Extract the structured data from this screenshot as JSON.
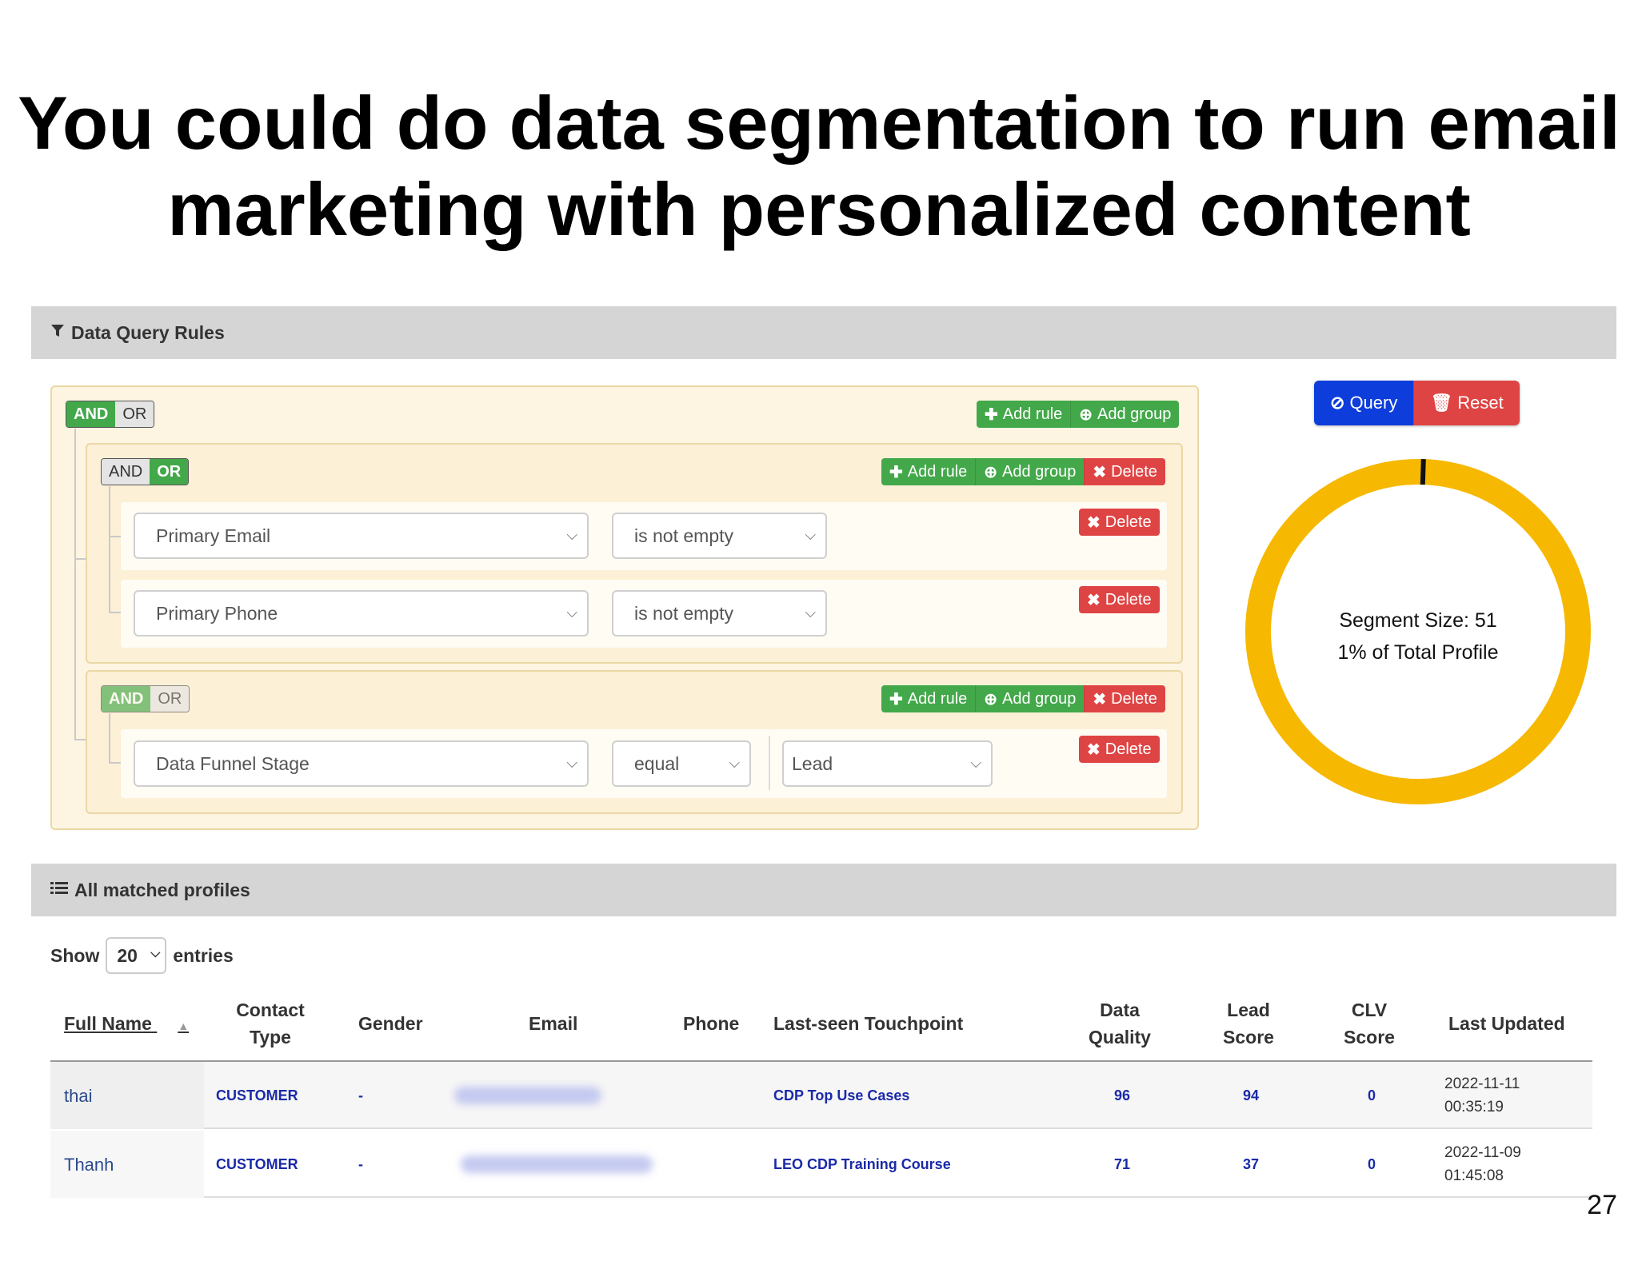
{
  "slide": {
    "title_line1": "You could do data segmentation to run email",
    "title_line2": "marketing with personalized content",
    "page_number": "27"
  },
  "query_section": {
    "title": "Data Query Rules",
    "icon": "filter-icon"
  },
  "root_group": {
    "and_label": "AND",
    "or_label": "OR",
    "active": "AND",
    "add_rule": "Add rule",
    "add_group": "Add group"
  },
  "group1": {
    "and_label": "AND",
    "or_label": "OR",
    "active": "OR",
    "add_rule": "Add rule",
    "add_group": "Add group",
    "delete": "Delete",
    "rules": [
      {
        "field": "Primary Email",
        "operator": "is not empty",
        "delete": "Delete"
      },
      {
        "field": "Primary Phone",
        "operator": "is not empty",
        "delete": "Delete"
      }
    ]
  },
  "group2": {
    "and_label": "AND",
    "or_label": "OR",
    "active": "AND",
    "add_rule": "Add rule",
    "add_group": "Add group",
    "delete": "Delete",
    "rules": [
      {
        "field": "Data Funnel Stage",
        "operator": "equal",
        "value": "Lead",
        "delete": "Delete"
      }
    ]
  },
  "actions": {
    "query": "Query",
    "reset": "Reset",
    "query_color": "#0d3ddb",
    "reset_color": "#df4444"
  },
  "segment": {
    "size_text": "Segment Size: 51",
    "percent_text": "1% of Total Profile",
    "fraction": 0.01,
    "ring_color": "#f6b800"
  },
  "profiles_section": {
    "title": "All matched profiles",
    "icon": "list-icon"
  },
  "table": {
    "show_label": "Show",
    "entries_value": "20",
    "entries_label": "entries",
    "headers": {
      "full_name": "Full Name",
      "contact_type_1": "Contact",
      "contact_type_2": "Type",
      "gender": "Gender",
      "email": "Email",
      "phone": "Phone",
      "touchpoint": "Last-seen Touchpoint",
      "quality_1": "Data",
      "quality_2": "Quality",
      "lead_1": "Lead",
      "lead_2": "Score",
      "clv_1": "CLV",
      "clv_2": "Score",
      "updated": "Last Updated"
    },
    "rows": [
      {
        "name": "thai",
        "type": "CUSTOMER",
        "gender": "-",
        "touchpoint": "CDP Top Use Cases",
        "quality": "96",
        "lead": "94",
        "clv": "0",
        "date": "2022-11-11",
        "time": "00:35:19"
      },
      {
        "name": "Thanh",
        "type": "CUSTOMER",
        "gender": "-",
        "touchpoint": "LEO CDP Training Course",
        "quality": "71",
        "lead": "37",
        "clv": "0",
        "date": "2022-11-09",
        "time": "01:45:08"
      }
    ]
  }
}
